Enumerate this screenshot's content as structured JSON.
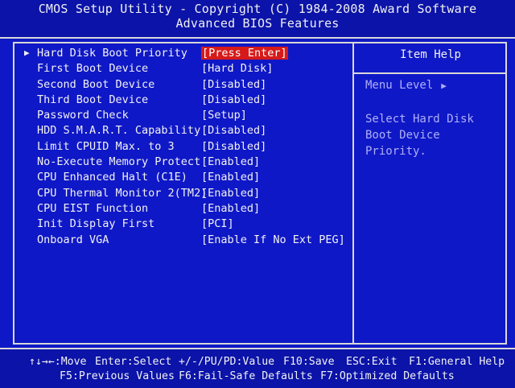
{
  "header": {
    "title": "CMOS Setup Utility - Copyright (C) 1984-2008 Award Software",
    "subtitle": "Advanced BIOS Features"
  },
  "settings": [
    {
      "label": "Hard Disk Boot Priority",
      "value": "[Press Enter]",
      "selected": true,
      "submenu": true
    },
    {
      "label": "First Boot Device",
      "value": "[Hard Disk]"
    },
    {
      "label": "Second Boot Device",
      "value": "[Disabled]"
    },
    {
      "label": "Third Boot Device",
      "value": "[Disabled]"
    },
    {
      "label": "Password Check",
      "value": "[Setup]"
    },
    {
      "label": "HDD S.M.A.R.T. Capability",
      "value": "[Disabled]"
    },
    {
      "label": "Limit CPUID Max. to 3",
      "value": "[Disabled]"
    },
    {
      "label": "No-Execute Memory Protect",
      "value": "[Enabled]"
    },
    {
      "label": "CPU Enhanced Halt (C1E)",
      "value": "[Enabled]"
    },
    {
      "label": "CPU Thermal Monitor 2(TM2)",
      "value": "[Enabled]"
    },
    {
      "label": "CPU EIST Function",
      "value": "[Enabled]"
    },
    {
      "label": "Init Display First",
      "value": "[PCI]"
    },
    {
      "label": "Onboard VGA",
      "value": "[Enable If No Ext PEG]"
    }
  ],
  "help": {
    "title": "Item Help",
    "menu_level": "Menu Level",
    "text": "Select Hard Disk Boot Device Priority."
  },
  "footer": {
    "move": "↑↓→←:Move",
    "enter": "Enter:Select",
    "value": "+/-/PU/PD:Value",
    "save": "F10:Save",
    "exit": "ESC:Exit",
    "help": "F1:General Help",
    "prev": "F5:Previous Values",
    "failsafe": "F6:Fail-Safe Defaults",
    "optimized": "F7:Optimized Defaults"
  },
  "colors": {
    "background": "#0f18c6",
    "highlight": "#d61a1a",
    "frame": "#d8d8d8"
  },
  "icons": {
    "submenu": "right-triangle-icon",
    "menu_level": "right-triangle-icon"
  }
}
